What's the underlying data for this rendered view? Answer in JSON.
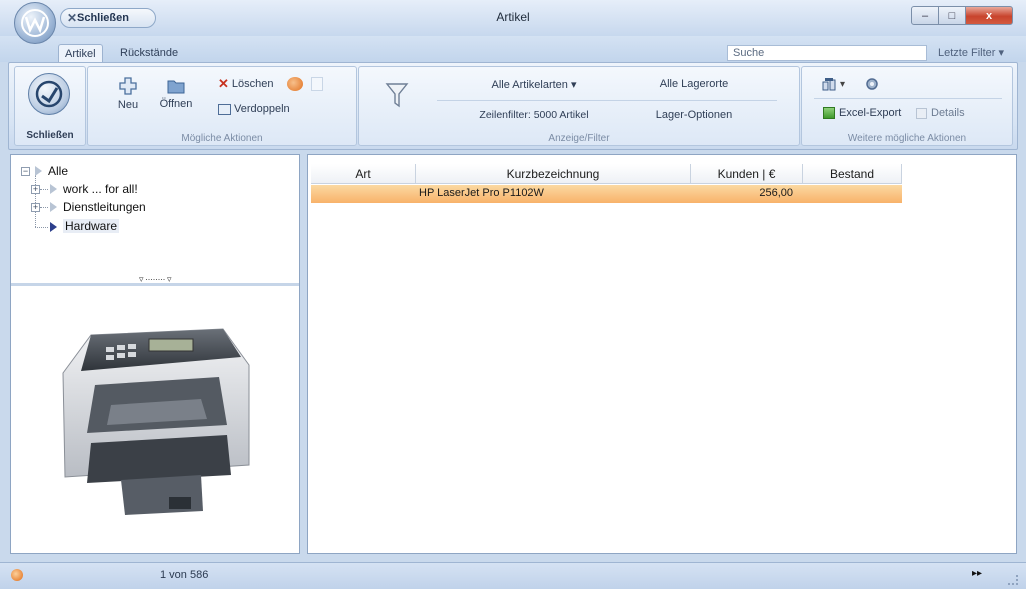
{
  "window": {
    "title": "Artikel",
    "close_pill_label": "Schließen",
    "minimize_glyph": "‒",
    "maximize_glyph": "□",
    "close_glyph": "x"
  },
  "tabs": [
    {
      "label": "Artikel",
      "active": true
    },
    {
      "label": "Rückstände",
      "active": false
    }
  ],
  "search": {
    "label": "Suche"
  },
  "filters_button": {
    "label": "Letzte Filter",
    "arrow": "▾"
  },
  "ribbon": {
    "close_group": {
      "button_label": "Schließen"
    },
    "actions_group": {
      "label": "Mögliche Aktionen",
      "new_label": "Neu",
      "open_label": "Öffnen",
      "delete_label": "Löschen",
      "duplicate_label": "Verdoppeln"
    },
    "filter_group": {
      "label": "Anzeige/Filter",
      "article_types_label": "Alle Artikelarten",
      "article_types_arrow": "▾",
      "locations_label": "Alle Lagerorte",
      "row_filter_label": "Zeilenfilter: 5000 Artikel",
      "storage_options_label": "Lager-Optionen"
    },
    "more_group": {
      "label": "Weitere mögliche Aktionen",
      "dropdown_arrow": "▾",
      "excel_export_label": "Excel-Export",
      "details_label": "Details"
    }
  },
  "tree": {
    "root": "Alle",
    "items": [
      "work ... for all!",
      "Dienstleitungen",
      "Hardware"
    ],
    "selected": "Hardware",
    "splitter_dots": "▿ ········ ▿"
  },
  "grid": {
    "columns": [
      "Art",
      "Kurzbezeichnung",
      "Kunden | €",
      "Bestand"
    ],
    "rows": [
      {
        "art": "",
        "kurzbezeichnung": "HP LaserJet Pro P1102W",
        "kunden": "256,00",
        "bestand": ""
      }
    ]
  },
  "statusbar": {
    "record_info": "1 von 586",
    "nav_glyph": "▸▸"
  },
  "colors": {
    "selection": "#f8b26a",
    "accent": "#c8442d"
  }
}
